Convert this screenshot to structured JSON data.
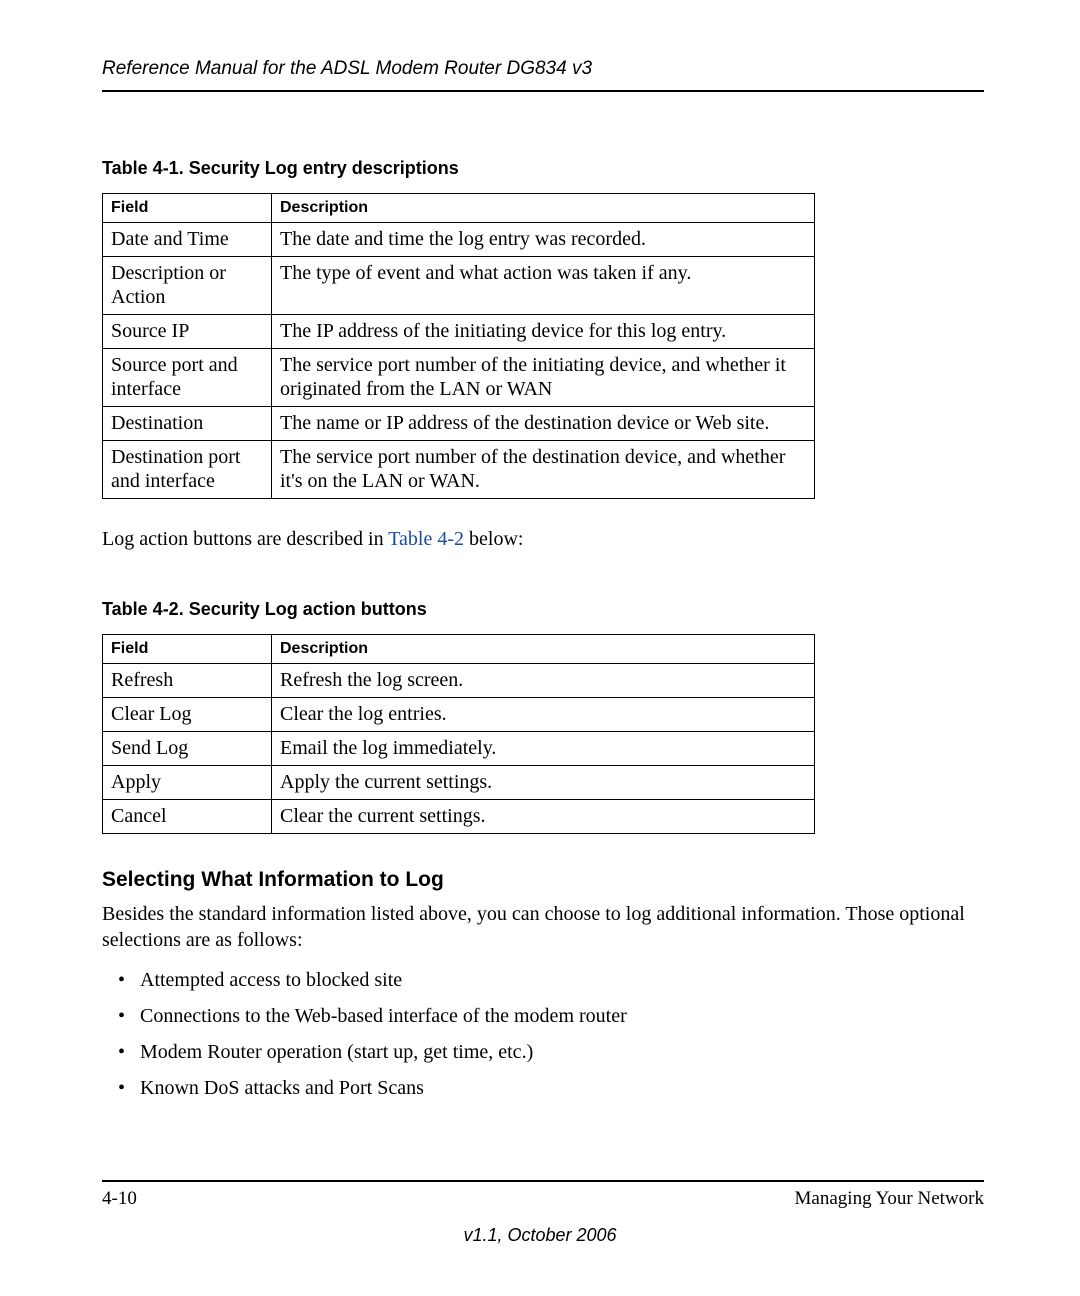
{
  "header": "Reference Manual for the ADSL Modem Router DG834 v3",
  "table1": {
    "caption": "Table 4-1. Security Log entry descriptions",
    "head": {
      "c0": "Field",
      "c1": "Description"
    },
    "rows": [
      {
        "c0": "Date and Time",
        "c1": "The date and time the log entry was recorded."
      },
      {
        "c0": "Description or Action",
        "c1": "The type of event and what action was taken if any."
      },
      {
        "c0": "Source IP",
        "c1": "The IP address of the initiating device for this log entry."
      },
      {
        "c0": "Source port and interface",
        "c1": "The service port number of the initiating device, and whether it originated from the LAN or WAN"
      },
      {
        "c0": "Destination",
        "c1": "The name or IP address of the destination device or Web site."
      },
      {
        "c0": "Destination port and interface",
        "c1": "The service port number of the destination device, and whether it's on the LAN or WAN."
      }
    ]
  },
  "mid_para_pre": "Log action buttons are described in ",
  "mid_para_link": "Table 4-2",
  "mid_para_post": " below:",
  "table2": {
    "caption": "Table 4-2. Security Log action buttons",
    "head": {
      "c0": "Field",
      "c1": "Description"
    },
    "rows": [
      {
        "c0": "Refresh",
        "c1": "Refresh the log screen."
      },
      {
        "c0": "Clear Log",
        "c1": "Clear the log entries."
      },
      {
        "c0": "Send Log",
        "c1": "Email the log immediately."
      },
      {
        "c0": "Apply",
        "c1": "Apply the current settings."
      },
      {
        "c0": "Cancel",
        "c1": "Clear the current settings."
      }
    ]
  },
  "section_heading": "Selecting What Information to Log",
  "section_para": "Besides the standard information listed above, you can choose to log additional information. Those optional selections are as follows:",
  "options": [
    "Attempted access to blocked site",
    "Connections to the Web-based interface of the modem router",
    "Modem Router operation (start up, get time, etc.)",
    "Known DoS attacks and Port Scans"
  ],
  "footer": {
    "page": "4-10",
    "chapter": "Managing Your Network"
  },
  "version": "v1.1, October 2006"
}
